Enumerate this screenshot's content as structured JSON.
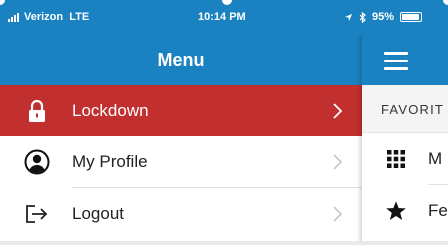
{
  "status_bar": {
    "carrier": "Verizon",
    "network": "LTE",
    "time": "10:14 PM",
    "battery": "95%",
    "icons": [
      "signal-bars-icon",
      "location-arrow-icon",
      "bluetooth-icon",
      "battery-icon"
    ]
  },
  "menu": {
    "title": "Menu",
    "items": [
      {
        "label": "Lockdown",
        "icon": "lock-icon",
        "active": true
      },
      {
        "label": "My Profile",
        "icon": "profile-icon",
        "active": false
      },
      {
        "label": "Logout",
        "icon": "logout-icon",
        "active": false
      }
    ]
  },
  "peek": {
    "favorites_label": "FAVORIT",
    "rows": [
      {
        "label": "M",
        "icon": "grid-icon"
      },
      {
        "label": "Fe",
        "icon": "star-icon"
      }
    ]
  },
  "colors": {
    "header_blue": "#1a82c0",
    "active_red": "#c12f2f",
    "divider": "#dedede"
  }
}
